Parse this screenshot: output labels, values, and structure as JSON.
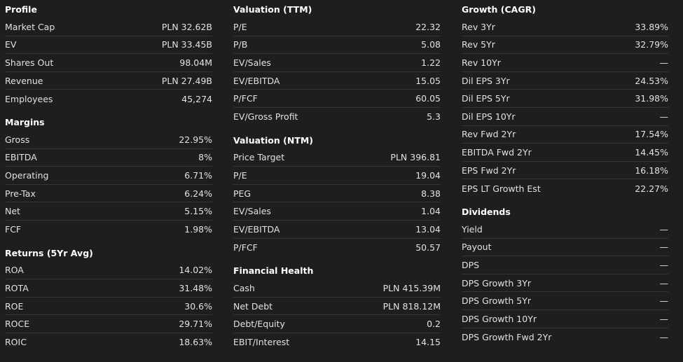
{
  "profile": {
    "title": "Profile",
    "rows": [
      {
        "label": "Market Cap",
        "value": "PLN 32.62B"
      },
      {
        "label": "EV",
        "value": "PLN 33.45B"
      },
      {
        "label": "Shares Out",
        "value": "98.04M"
      },
      {
        "label": "Revenue",
        "value": "PLN 27.49B"
      },
      {
        "label": "Employees",
        "value": "45,274"
      }
    ]
  },
  "margins": {
    "title": "Margins",
    "rows": [
      {
        "label": "Gross",
        "value": "22.95%"
      },
      {
        "label": "EBITDA",
        "value": "8%"
      },
      {
        "label": "Operating",
        "value": "6.71%"
      },
      {
        "label": "Pre-Tax",
        "value": "6.24%"
      },
      {
        "label": "Net",
        "value": "5.15%"
      },
      {
        "label": "FCF",
        "value": "1.98%"
      }
    ]
  },
  "returns": {
    "title": "Returns (5Yr Avg)",
    "rows": [
      {
        "label": "ROA",
        "value": "14.02%"
      },
      {
        "label": "ROTA",
        "value": "31.48%"
      },
      {
        "label": "ROE",
        "value": "30.6%"
      },
      {
        "label": "ROCE",
        "value": "29.71%"
      },
      {
        "label": "ROIC",
        "value": "18.63%"
      }
    ]
  },
  "valuation_ttm": {
    "title": "Valuation (TTM)",
    "rows": [
      {
        "label": "P/E",
        "value": "22.32"
      },
      {
        "label": "P/B",
        "value": "5.08"
      },
      {
        "label": "EV/Sales",
        "value": "1.22"
      },
      {
        "label": "EV/EBITDA",
        "value": "15.05"
      },
      {
        "label": "P/FCF",
        "value": "60.05"
      },
      {
        "label": "EV/Gross Profit",
        "value": "5.3"
      }
    ]
  },
  "valuation_ntm": {
    "title": "Valuation (NTM)",
    "rows": [
      {
        "label": "Price Target",
        "value": "PLN 396.81"
      },
      {
        "label": "P/E",
        "value": "19.04"
      },
      {
        "label": "PEG",
        "value": "8.38"
      },
      {
        "label": "EV/Sales",
        "value": "1.04"
      },
      {
        "label": "EV/EBITDA",
        "value": "13.04"
      },
      {
        "label": "P/FCF",
        "value": "50.57"
      }
    ]
  },
  "financial_health": {
    "title": "Financial Health",
    "rows": [
      {
        "label": "Cash",
        "value": "PLN 415.39M"
      },
      {
        "label": "Net Debt",
        "value": "PLN 818.12M"
      },
      {
        "label": "Debt/Equity",
        "value": "0.2"
      },
      {
        "label": "EBIT/Interest",
        "value": "14.15"
      }
    ]
  },
  "growth": {
    "title": "Growth (CAGR)",
    "rows": [
      {
        "label": "Rev 3Yr",
        "value": "33.89%"
      },
      {
        "label": "Rev 5Yr",
        "value": "32.79%"
      },
      {
        "label": "Rev 10Yr",
        "value": "—"
      },
      {
        "label": "Dil EPS 3Yr",
        "value": "24.53%"
      },
      {
        "label": "Dil EPS 5Yr",
        "value": "31.98%"
      },
      {
        "label": "Dil EPS 10Yr",
        "value": "—"
      },
      {
        "label": "Rev Fwd 2Yr",
        "value": "17.54%"
      },
      {
        "label": "EBITDA Fwd 2Yr",
        "value": "14.45%"
      },
      {
        "label": "EPS Fwd 2Yr",
        "value": "16.18%"
      },
      {
        "label": "EPS LT Growth Est",
        "value": "22.27%"
      }
    ]
  },
  "dividends": {
    "title": "Dividends",
    "rows": [
      {
        "label": "Yield",
        "value": "—"
      },
      {
        "label": "Payout",
        "value": "—"
      },
      {
        "label": "DPS",
        "value": "—"
      },
      {
        "label": "DPS Growth 3Yr",
        "value": "—"
      },
      {
        "label": "DPS Growth 5Yr",
        "value": "—"
      },
      {
        "label": "DPS Growth 10Yr",
        "value": "—"
      },
      {
        "label": "DPS Growth Fwd 2Yr",
        "value": "—"
      }
    ]
  }
}
